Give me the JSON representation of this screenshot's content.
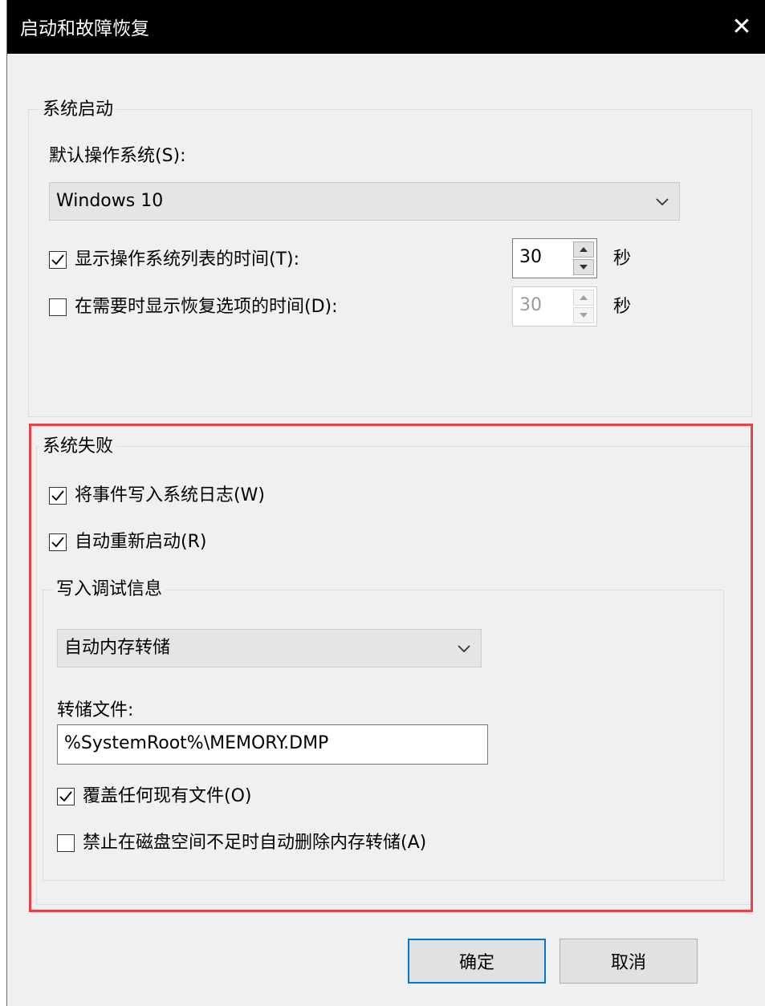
{
  "window": {
    "title": "启动和故障恢复",
    "close_glyph": "✕"
  },
  "startup": {
    "group_label": "系统启动",
    "default_os_label": "默认操作系统(S):",
    "default_os_value": "Windows 10",
    "show_list": {
      "checked": true,
      "label": "显示操作系统列表的时间(T):",
      "value": "30",
      "unit": "秒"
    },
    "show_recovery": {
      "checked": false,
      "label": "在需要时显示恢复选项的时间(D):",
      "value": "30",
      "unit": "秒"
    }
  },
  "failure": {
    "group_label": "系统失败",
    "write_event": {
      "checked": true,
      "label": "将事件写入系统日志(W)"
    },
    "auto_restart": {
      "checked": true,
      "label": "自动重新启动(R)"
    },
    "debug": {
      "group_label": "写入调试信息",
      "dump_type_value": "自动内存转储",
      "dump_file_label": "转储文件:",
      "dump_file_value": "%SystemRoot%\\MEMORY.DMP",
      "overwrite": {
        "checked": true,
        "label": "覆盖任何现有文件(O)"
      },
      "disable_autodelete": {
        "checked": false,
        "label": "禁止在磁盘空间不足时自动删除内存转储(A)"
      }
    }
  },
  "buttons": {
    "ok_label": "确定",
    "cancel_label": "取消"
  },
  "colors": {
    "highlight_border": "#e8414a",
    "accent": "#0078d7",
    "titlebar": "#000000"
  }
}
